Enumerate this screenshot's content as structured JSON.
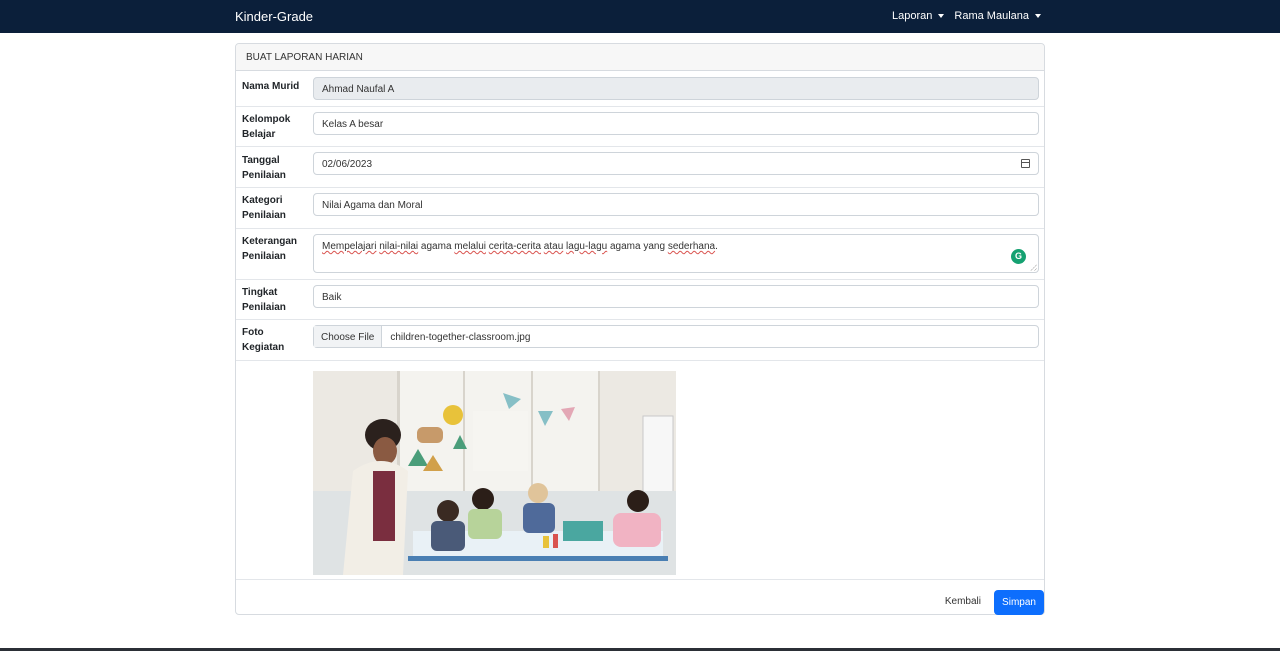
{
  "navbar": {
    "brand": "Kinder-Grade",
    "menu": [
      {
        "label": "Laporan"
      },
      {
        "label": "Rama Maulana"
      }
    ]
  },
  "card": {
    "title": "BUAT LAPORAN HARIAN",
    "fields": {
      "nama_murid": {
        "label": "Nama Murid",
        "value": "Ahmad Naufal A"
      },
      "kelompok_belajar": {
        "label": "Kelompok Belajar",
        "value": "Kelas A besar"
      },
      "tanggal_penilaian": {
        "label": "Tanggal Penilaian",
        "value": "02/06/2023"
      },
      "kategori_penilaian": {
        "label": "Kategori Penilaian",
        "value": "Nilai Agama dan Moral"
      },
      "keterangan_penilaian": {
        "label": "Keterangan Penilaian",
        "parts": [
          "Mempelajari",
          " ",
          "nilai-nilai",
          " agama ",
          "melalui",
          " ",
          "cerita-cerita",
          " ",
          "atau",
          " ",
          "lagu-lagu",
          " agama yang ",
          "sederhana",
          "."
        ]
      },
      "tingkat_penilaian": {
        "label": "Tingkat Penilaian",
        "value": "Baik"
      },
      "foto_kegiatan": {
        "label": "Foto Kegiatan",
        "button": "Choose File",
        "file_name": "children-together-classroom.jpg"
      }
    },
    "grammarly_icon": "G",
    "buttons": {
      "back": "Kembali",
      "save": "Simpan"
    }
  },
  "colors": {
    "navbar": "#0b1f3a",
    "primary": "#0d6efd",
    "readonly_bg": "#e9ecef",
    "grammarly": "#15a171"
  },
  "icons": {
    "calendar": "calendar-icon",
    "dropdown": "chevron-down-icon"
  }
}
